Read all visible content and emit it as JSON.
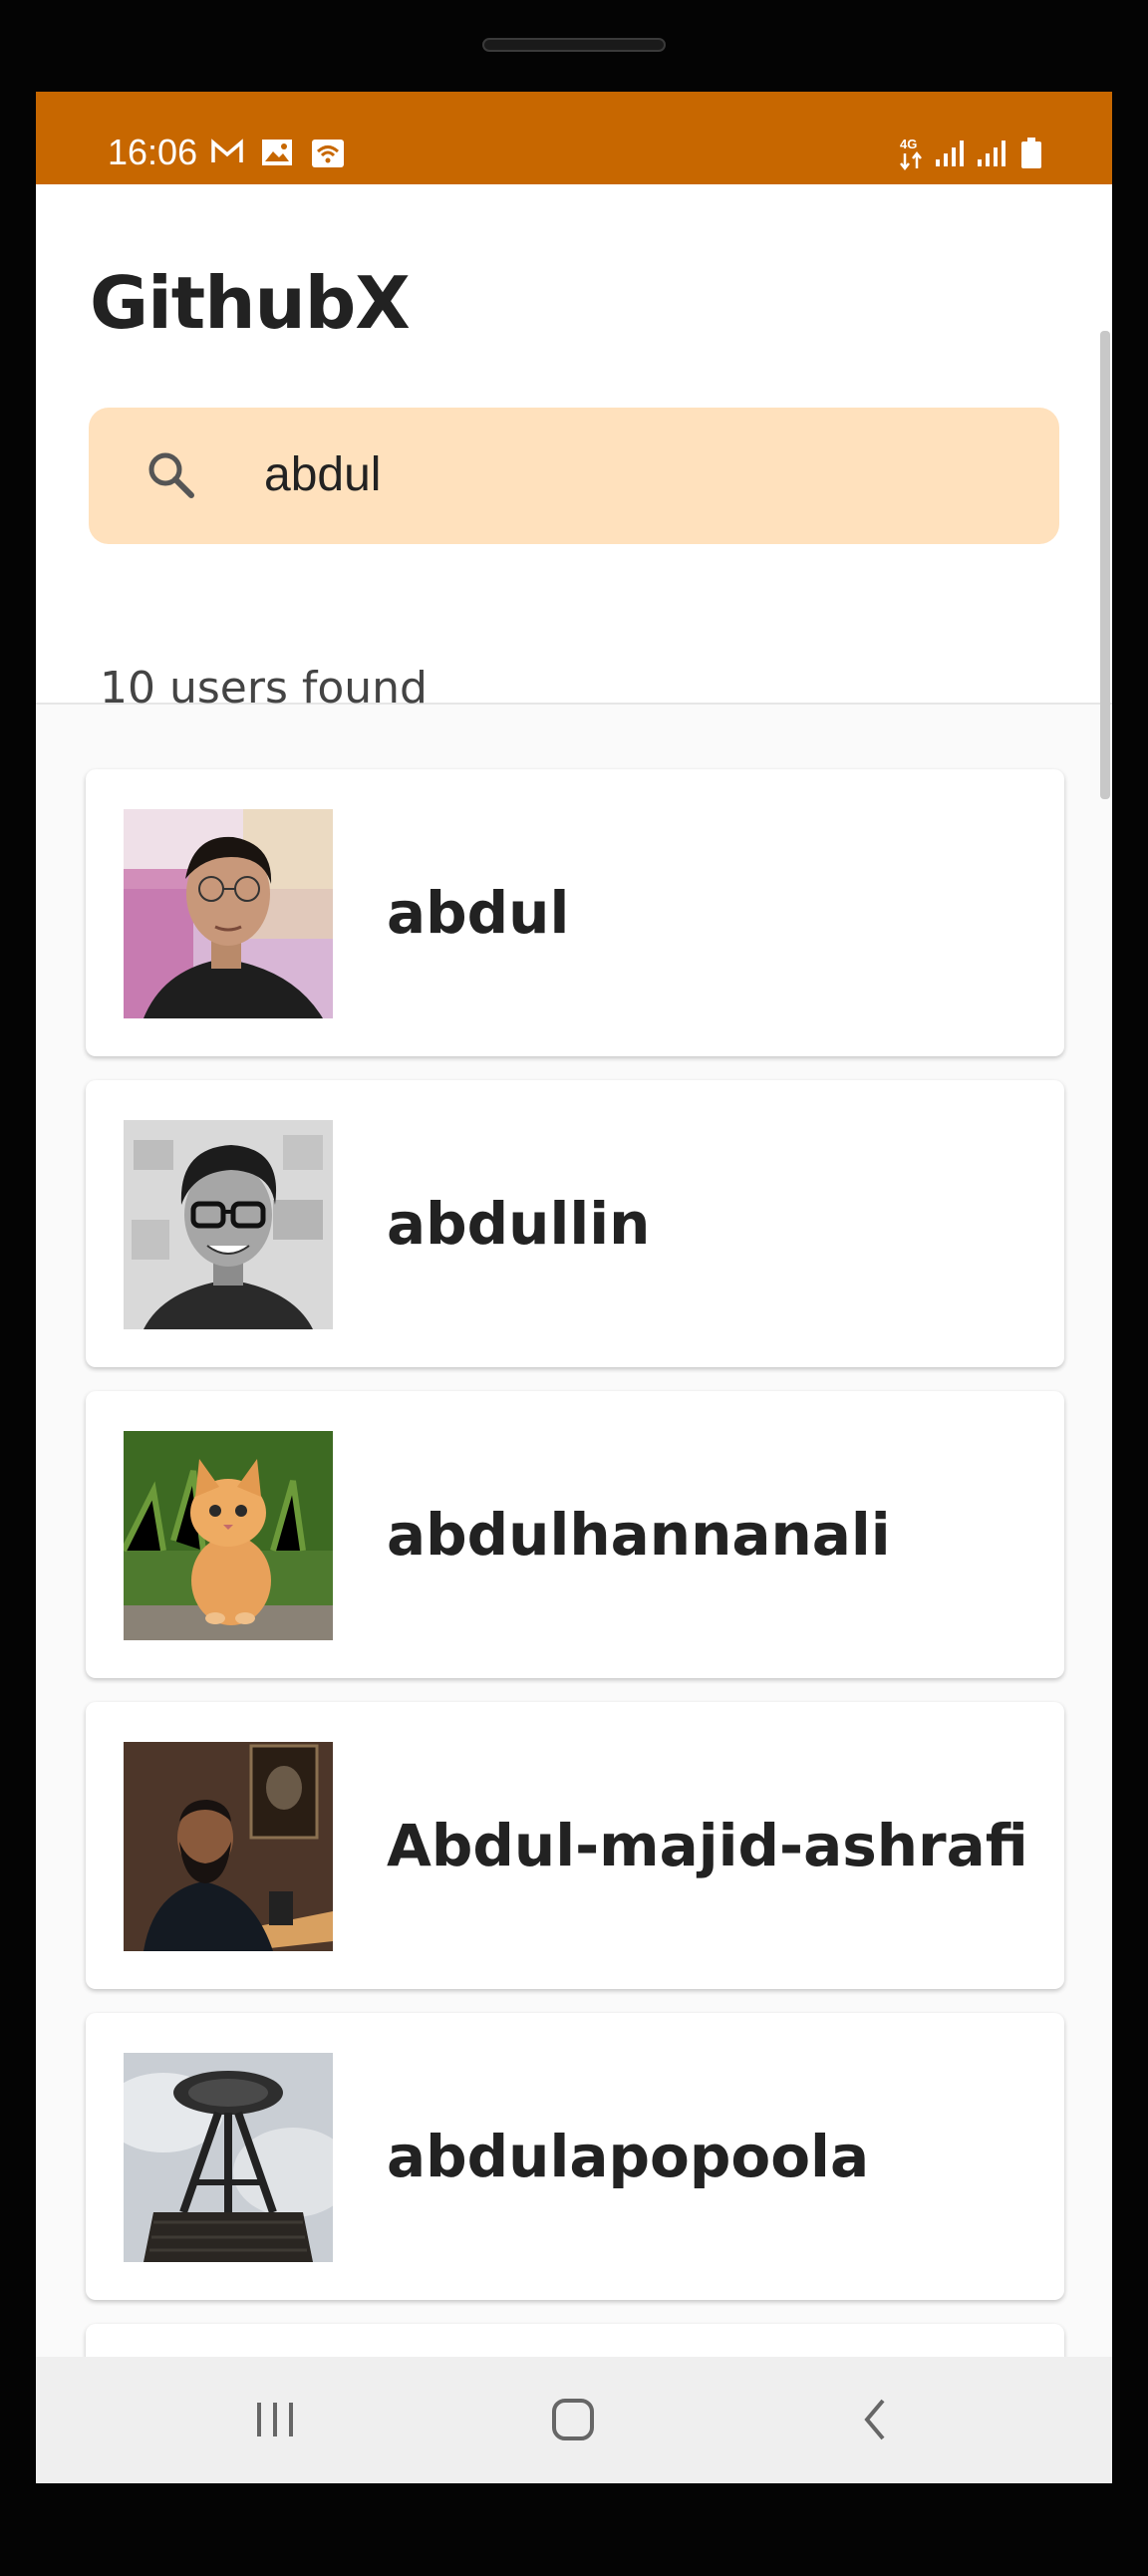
{
  "status_bar": {
    "time": "16:06",
    "left_icons": [
      "gmail-icon",
      "gallery-icon",
      "wifi-hotspot-icon"
    ],
    "right_icons": [
      "4g-icon",
      "signal-icon",
      "signal-icon",
      "battery-icon"
    ],
    "network_label": "4G"
  },
  "app": {
    "title": "GithubX",
    "search": {
      "value": "abdul",
      "placeholder": ""
    },
    "result_count_text": "10 users found"
  },
  "users": [
    {
      "login": "abdul",
      "avatar": "portrait-man-glasses"
    },
    {
      "login": "abdullin",
      "avatar": "portrait-man-smiling-glasses"
    },
    {
      "login": "abdulhannanali",
      "avatar": "kitten-on-grass"
    },
    {
      "login": "Abdul-majid-ashrafi",
      "avatar": "man-speaking-at-desk"
    },
    {
      "login": "abdulapopoola",
      "avatar": "space-needle-tower"
    }
  ],
  "nav_bar": {
    "buttons": [
      "recent-apps-icon",
      "home-icon",
      "back-icon"
    ]
  },
  "colors": {
    "status_bar": "#c76700",
    "search_bg": "#ffe1bd",
    "card_bg": "#ffffff",
    "page_bg": "#fafafa"
  }
}
